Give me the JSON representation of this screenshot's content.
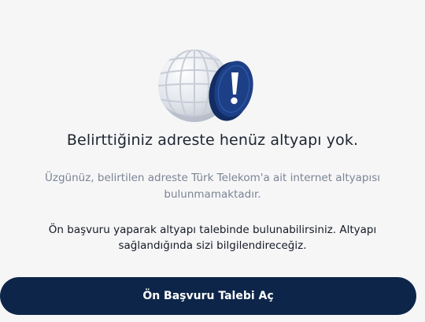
{
  "dialog": {
    "illustration_icon": "globe-with-alert-icon",
    "title": "Belirttiğiniz adreste henüz altyapı yok.",
    "subtitle": "Üzgünüz, belirtilen adreste Türk Telekom'a ait internet altyapısı bulunmamaktadır.",
    "notice": "Ön başvuru yaparak altyapı talebinde bulunabilirsiniz. Altyapı sağlandığında sizi bilgilendireceğiz.",
    "cta_label": "Ön Başvuru Talebi Aç"
  },
  "colors": {
    "background": "#f6f6f7",
    "primary": "#0d2548",
    "alert_badge": "#1d3f86",
    "muted_text": "#7b8494"
  }
}
